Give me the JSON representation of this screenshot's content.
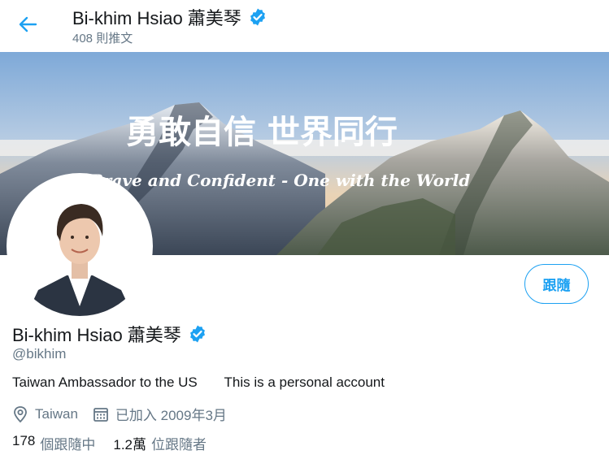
{
  "header": {
    "display_name": "Bi-khim Hsiao 蕭美琴",
    "tweet_count": "408 則推文"
  },
  "banner": {
    "title_chinese": "勇敢自信 世界同行",
    "title_english": "Brave and Confident - One with the World"
  },
  "profile": {
    "display_name": "Bi-khim Hsiao 蕭美琴",
    "handle": "@bikhim",
    "bio": "Taiwan Ambassador to the US       This is a personal account",
    "location": "Taiwan",
    "joined": "已加入 2009年3月",
    "follow_label": "跟隨"
  },
  "stats": {
    "following_count": "178",
    "following_label": "個跟隨中",
    "followers_count": "1.2萬",
    "followers_label": "位跟隨者"
  },
  "colors": {
    "accent": "#1da1f2",
    "secondary_text": "#657786",
    "primary_text": "#14171a"
  },
  "icons": {
    "back": "arrow-left-icon",
    "verified": "verified-badge-icon",
    "location": "location-pin-icon",
    "calendar": "calendar-icon"
  }
}
